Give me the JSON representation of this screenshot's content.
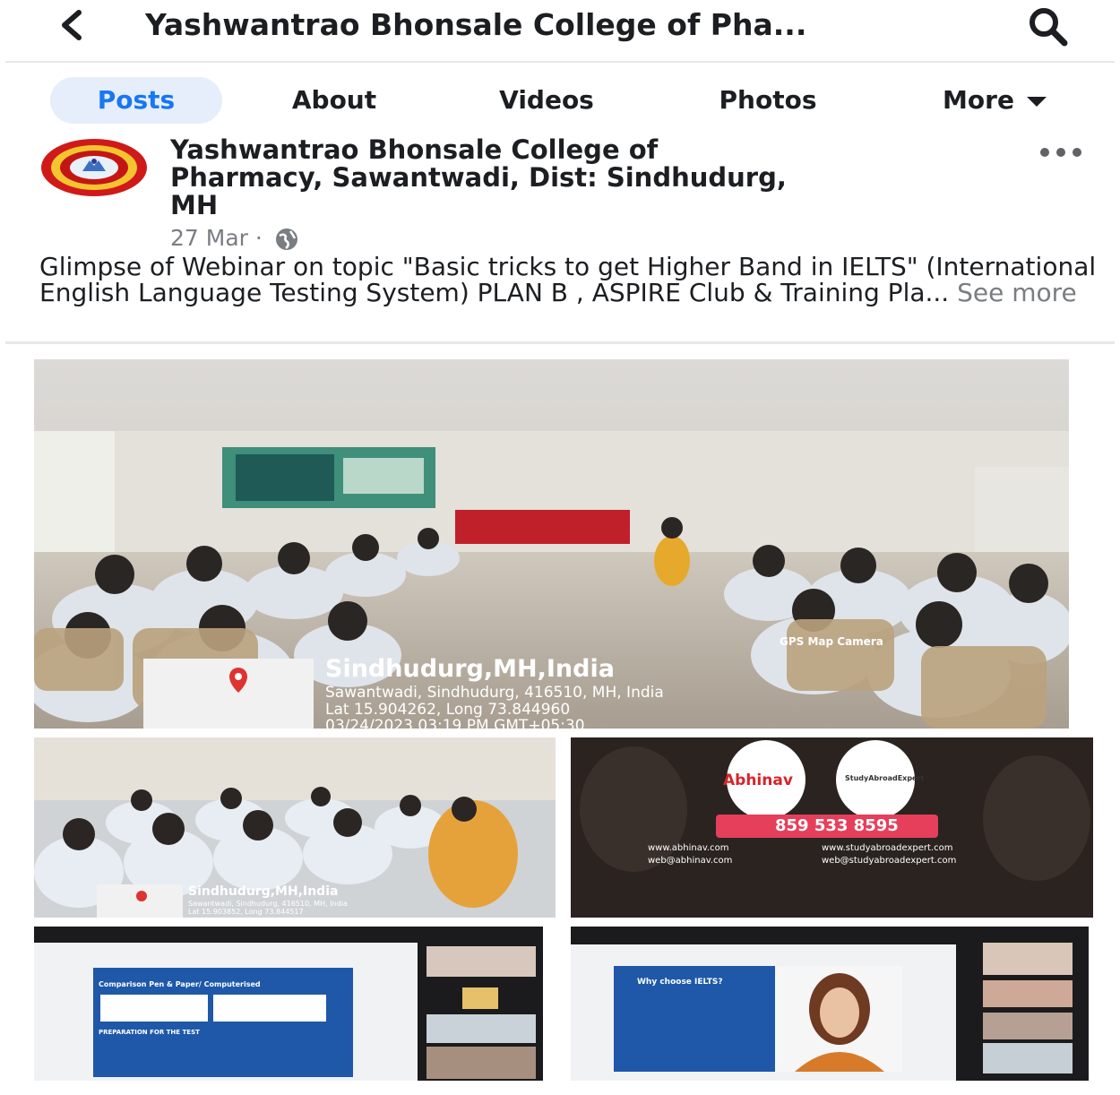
{
  "header": {
    "title": "Yashwantrao Bhonsale College of Pha...",
    "back_icon": "back-arrow-icon",
    "search_icon": "search-icon"
  },
  "tabs": [
    {
      "label": "Posts",
      "active": true
    },
    {
      "label": "About",
      "active": false
    },
    {
      "label": "Videos",
      "active": false
    },
    {
      "label": "Photos",
      "active": false
    },
    {
      "label": "More",
      "active": false
    }
  ],
  "post": {
    "author_line1": "Yashwantrao Bhonsale College of",
    "author_line2": "Pharmacy, Sawantwadi, Dist: Sindhudurg,",
    "author_line3": "MH",
    "date": "27 Mar ·",
    "text": "Glimpse of Webinar on topic \"Basic tricks to get Higher Band in IELTS\" (International English Language Testing System) PLAN B , ASPIRE Club & Training Pla...",
    "see_more": "See more"
  },
  "photos": {
    "main": {
      "city": "Sindhudurg,MH,India",
      "address": "Sawantwadi, Sindhudurg, 416510, MH, India",
      "latlong": "Lat 15.904262, Long 73.844960",
      "timestamp": "03/24/2023 03:19 PM GMT+05:30",
      "camera": "GPS Map Camera"
    },
    "small_left": {
      "city": "Sindhudurg,MH,India",
      "address": "Sawantwadi, Sindhudurg, 416510, MH, India",
      "latlong": "Lat 15.903852, Long 73.844517"
    },
    "flyer": {
      "brand": "Abhinav",
      "partner": "StudyAbroadExpert",
      "phone": "859 533 8595",
      "web1": "www.abhinav.com",
      "web2": "www.studyabroadexpert.com",
      "mail1": "web@abhinav.com",
      "mail2": "web@studyabroadexpert.com"
    },
    "slide_left": {
      "title": "Comparison Pen & Paper/ Computerised",
      "subtitle": "PREPARATION FOR THE TEST"
    },
    "slide_right": {
      "title": "Why choose IELTS?"
    }
  },
  "colors": {
    "accent": "#1877f2",
    "active_tab_bg": "#e6eefc",
    "meta_grey": "#7a7d82",
    "divider": "#e6e7ea"
  }
}
